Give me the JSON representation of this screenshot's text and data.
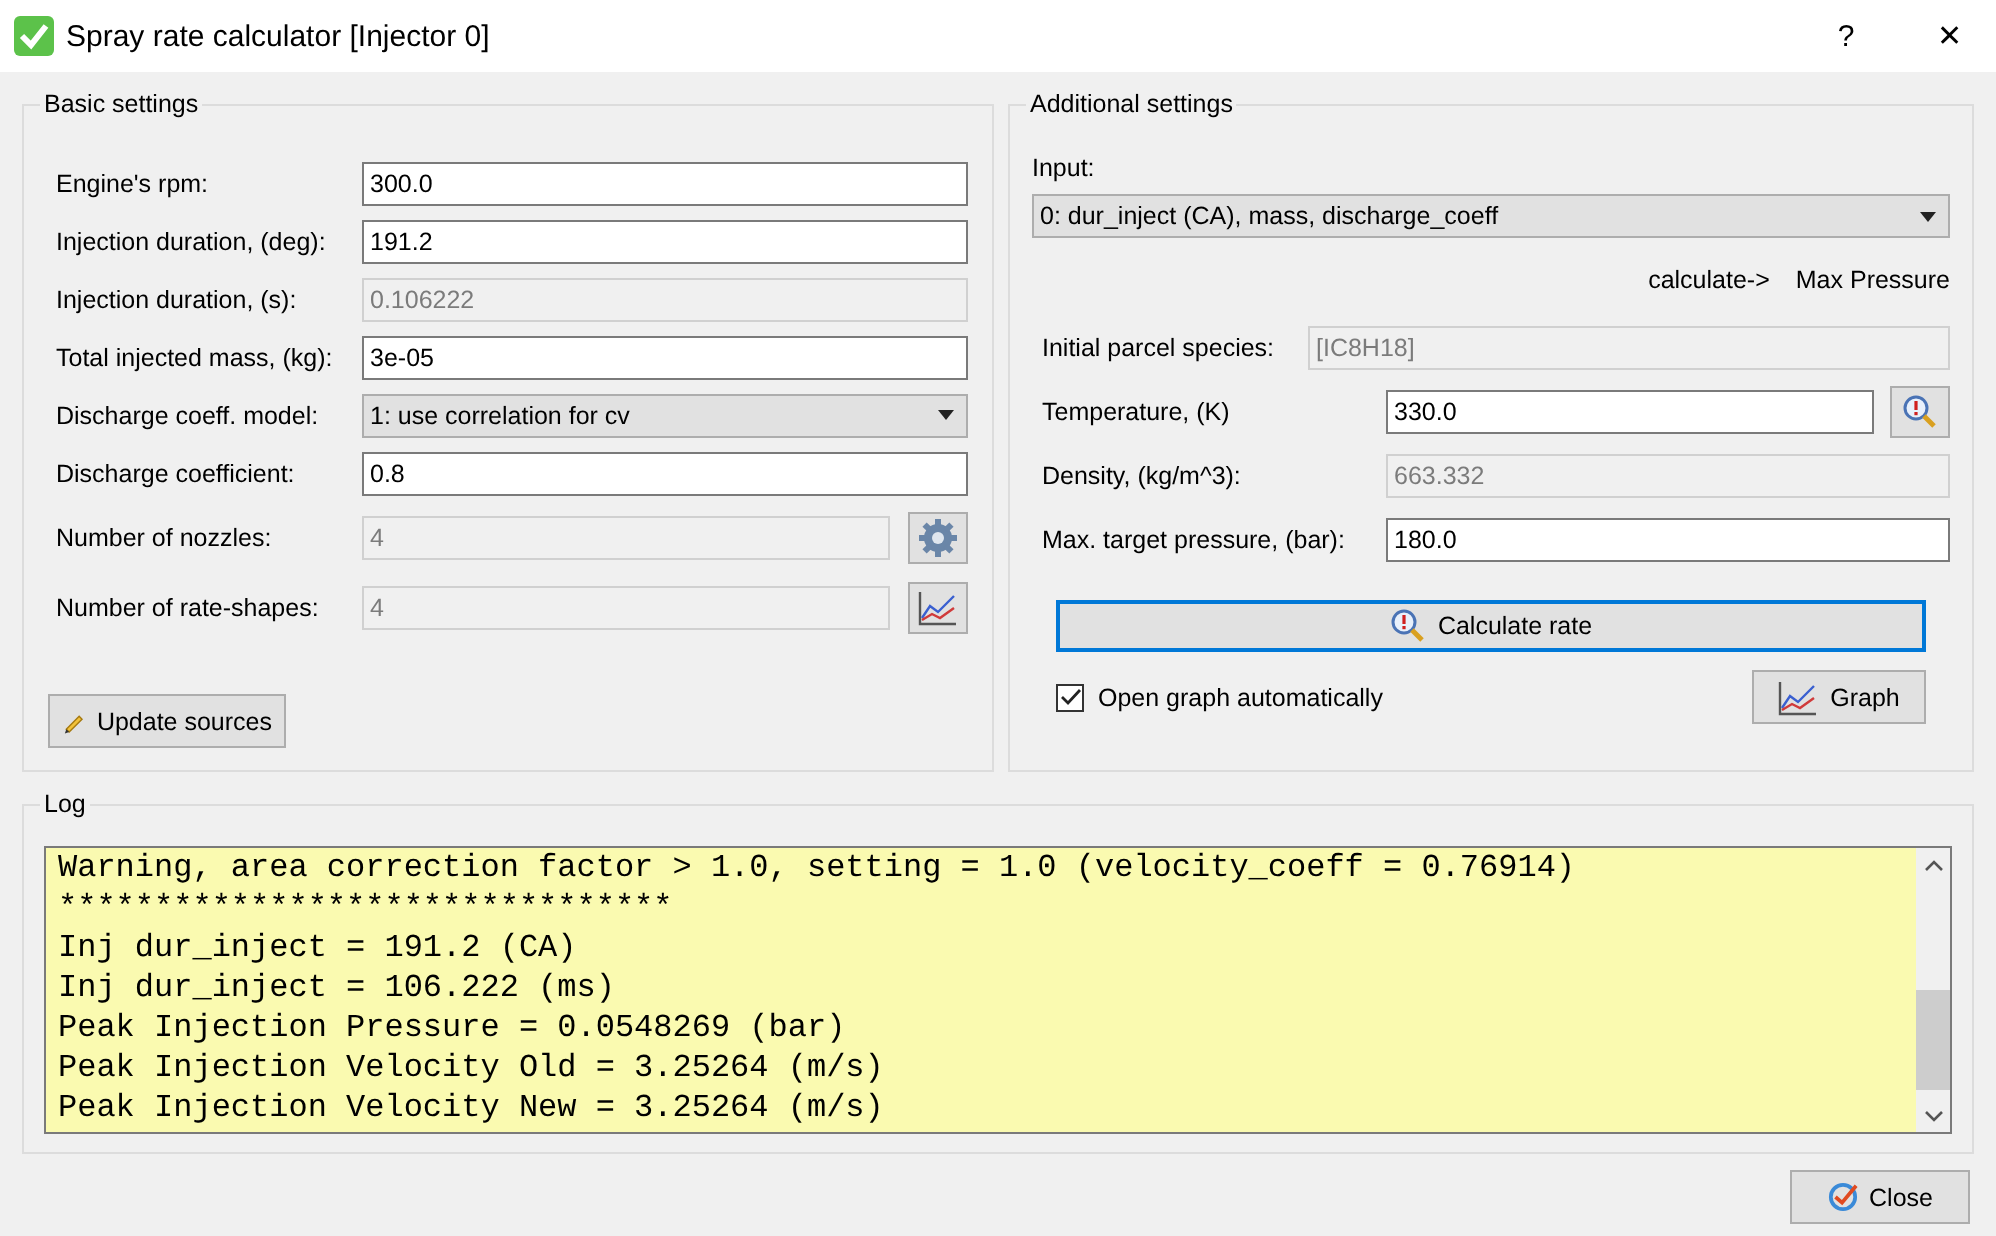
{
  "window": {
    "title": "Spray rate calculator [Injector 0]",
    "help": "?",
    "close": "✕"
  },
  "basic_settings": {
    "title": "Basic settings",
    "fields": [
      {
        "label": "Engine's rpm:",
        "kind": "text",
        "value": "300.0",
        "disabled": false
      },
      {
        "label": "Injection duration, (deg):",
        "kind": "text",
        "value": "191.2",
        "disabled": false
      },
      {
        "label": "Injection duration, (s):",
        "kind": "text",
        "value": "0.106222",
        "disabled": true
      },
      {
        "label": "Total injected mass, (kg):",
        "kind": "text",
        "value": "3e-05",
        "disabled": false
      },
      {
        "label": "Discharge coeff. model:",
        "kind": "select",
        "value": "1: use correlation for cv",
        "disabled": false
      },
      {
        "label": "Discharge coefficient:",
        "kind": "text",
        "value": "0.8",
        "disabled": false
      },
      {
        "label": "Number of nozzles:",
        "kind": "gear",
        "value": "4",
        "disabled": true
      },
      {
        "label": "Number of rate-shapes:",
        "kind": "chart",
        "value": "4",
        "disabled": true
      }
    ],
    "update_button": "Update sources"
  },
  "additional_settings": {
    "title": "Additional settings",
    "input_label": "Input:",
    "input_value": "0: dur_inject (CA), mass, discharge_coeff",
    "calculate_label": "calculate->",
    "calculate_target": "Max Pressure",
    "fields": [
      {
        "label": "Initial parcel species:",
        "kind": "wide",
        "value": "[IC8H18]",
        "disabled": true
      },
      {
        "label": "Temperature, (K)",
        "kind": "lookup",
        "value": "330.0",
        "disabled": false
      },
      {
        "label": "Density, (kg/m^3):",
        "kind": "text",
        "value": "663.332",
        "disabled": true
      },
      {
        "label": "Max. target pressure, (bar):",
        "kind": "text",
        "value": "180.0",
        "disabled": false
      }
    ],
    "calculate_button": "Calculate rate",
    "open_graph": {
      "label": "Open graph automatically",
      "checked": true
    },
    "graph_button": "Graph"
  },
  "log": {
    "title": "Log",
    "lines": [
      "Warning, area correction factor > 1.0, setting = 1.0 (velocity_coeff = 0.76914)",
      "********************************",
      "Inj dur_inject = 191.2 (CA)",
      "Inj dur_inject = 106.222 (ms)",
      "Peak Injection Pressure = 0.0548269 (bar)",
      "Peak Injection Velocity Old = 3.25264 (m/s)",
      "Peak Injection Velocity New = 3.25264 (m/s)"
    ]
  },
  "close_button": "Close"
}
